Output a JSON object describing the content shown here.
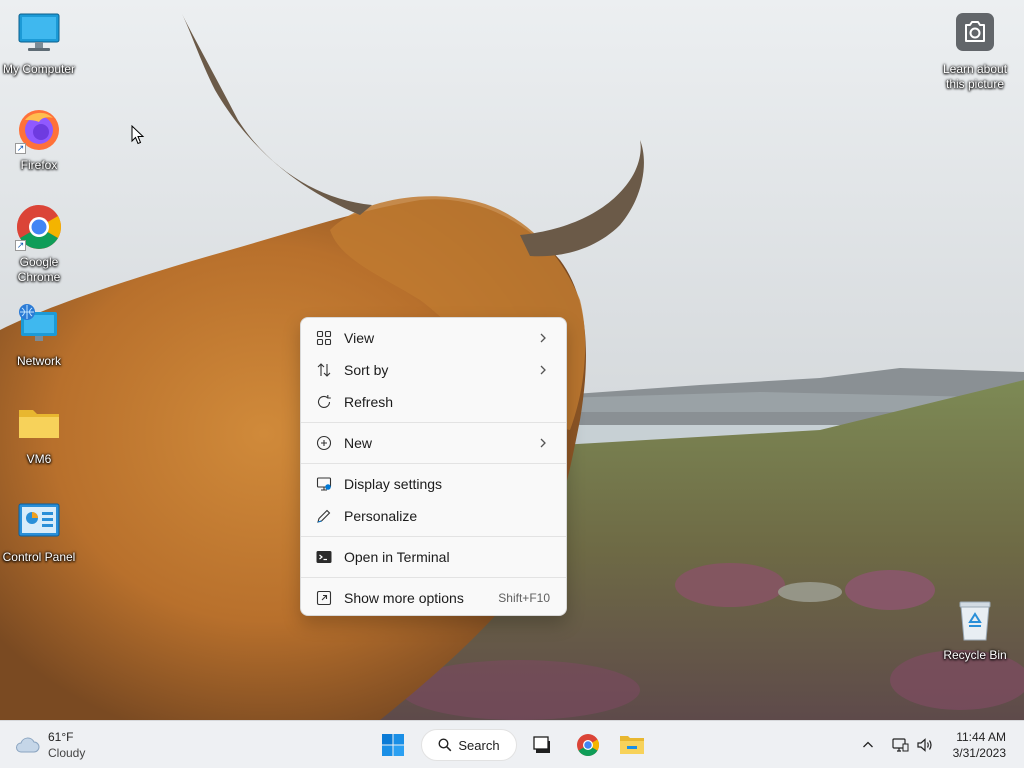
{
  "desktop_icons": [
    {
      "label": "My Computer",
      "icon": "monitor-icon"
    },
    {
      "label": "Firefox",
      "icon": "firefox-icon",
      "shortcut": true
    },
    {
      "label": "Google Chrome",
      "icon": "chrome-icon",
      "shortcut": true
    },
    {
      "label": "Network",
      "icon": "network-icon"
    },
    {
      "label": "VM6",
      "icon": "folder-icon"
    },
    {
      "label": "Control Panel",
      "icon": "control-panel-icon"
    },
    {
      "label": "Learn about this picture",
      "icon": "camera-icon"
    },
    {
      "label": "Recycle Bin",
      "icon": "recycle-bin-icon"
    }
  ],
  "context_menu": {
    "items": [
      {
        "label": "View",
        "icon": "grid-icon",
        "submenu": true
      },
      {
        "label": "Sort by",
        "icon": "sort-icon",
        "submenu": true
      },
      {
        "label": "Refresh",
        "icon": "refresh-icon"
      },
      {
        "label": "New",
        "icon": "add-circle-icon",
        "submenu": true
      },
      {
        "label": "Display settings",
        "icon": "display-settings-icon"
      },
      {
        "label": "Personalize",
        "icon": "pen-icon"
      },
      {
        "label": "Open in Terminal",
        "icon": "terminal-icon"
      },
      {
        "label": "Show more options",
        "icon": "more-options-icon",
        "shortcut": "Shift+F10"
      }
    ]
  },
  "taskbar": {
    "weather": {
      "temp": "61°F",
      "condition": "Cloudy"
    },
    "search_label": "Search",
    "clock": {
      "time": "11:44 AM",
      "date": "3/31/2023"
    }
  },
  "colors": {
    "accent": "#0078d4",
    "menu_bg": "#f9f9f9",
    "taskbar_bg": "#eef0f3"
  }
}
